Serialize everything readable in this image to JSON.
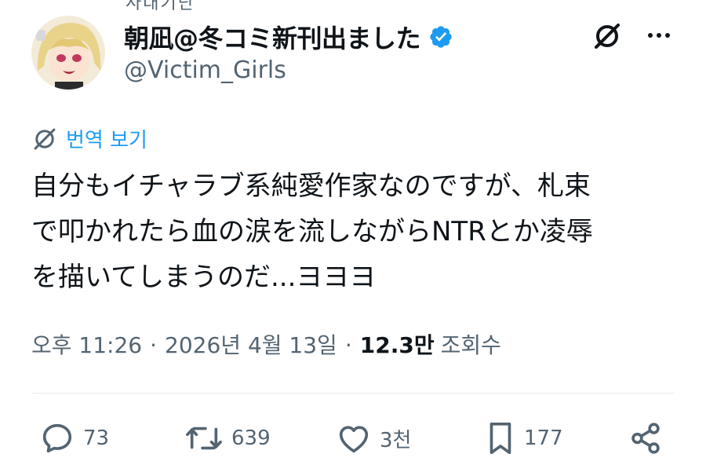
{
  "author": {
    "display_name": "朝凪@冬コミ新刊出ました",
    "handle": "@Victim_Girls"
  },
  "top_partial_text": "사대기단",
  "translate_label": "번역 보기",
  "tweet_lines": [
    "自分もイチャラブ系純愛作家なのですが、札束",
    "で叩かれたら血の涙を流しながらNTRとか凌辱",
    "を描いてしまうのだ...ヨヨヨ"
  ],
  "meta": {
    "time": "오후 11:26",
    "separator": "·",
    "date": "2026년 4월 13일",
    "views_count": "12.3만",
    "views_label": "조회수"
  },
  "actions": {
    "replies": "73",
    "reposts": "639",
    "likes": "3천",
    "bookmarks": "177"
  },
  "colors": {
    "accent": "#1d9bf0",
    "secondary_text": "#536471",
    "primary_text": "#0f1419"
  },
  "icons": [
    "verified-badge-icon",
    "grok-icon",
    "more-icon",
    "reply-icon",
    "repost-icon",
    "like-icon",
    "bookmark-icon",
    "share-icon"
  ]
}
